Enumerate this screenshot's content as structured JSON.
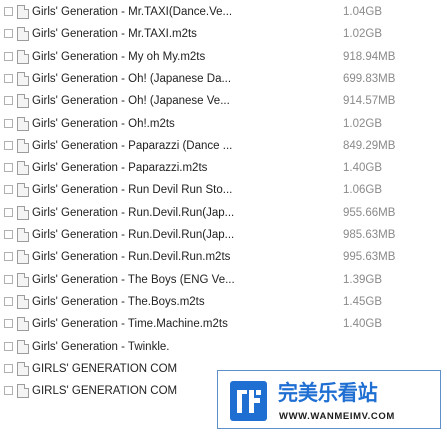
{
  "files": [
    {
      "name": "Girls' Generation - Mr.TAXI(Dance.Ve...",
      "size": "1.04GB"
    },
    {
      "name": "Girls' Generation - Mr.TAXI.m2ts",
      "size": "1.02GB"
    },
    {
      "name": "Girls' Generation - My oh My.m2ts",
      "size": "918.94MB"
    },
    {
      "name": "Girls' Generation - Oh! (Japanese Da...",
      "size": "699.83MB"
    },
    {
      "name": "Girls' Generation - Oh! (Japanese Ve...",
      "size": "914.57MB"
    },
    {
      "name": "Girls' Generation - Oh!.m2ts",
      "size": "1.02GB"
    },
    {
      "name": "Girls' Generation - Paparazzi (Dance ...",
      "size": "849.29MB"
    },
    {
      "name": "Girls' Generation - Paparazzi.m2ts",
      "size": "1.40GB"
    },
    {
      "name": "Girls' Generation - Run Devil Run Sto...",
      "size": "1.06GB"
    },
    {
      "name": "Girls' Generation - Run.Devil.Run(Jap...",
      "size": "955.66MB"
    },
    {
      "name": "Girls' Generation - Run.Devil.Run(Jap...",
      "size": "985.63MB"
    },
    {
      "name": "Girls' Generation - Run.Devil.Run.m2ts",
      "size": "995.63MB"
    },
    {
      "name": "Girls' Generation - The Boys (ENG Ve...",
      "size": "1.39GB"
    },
    {
      "name": "Girls' Generation - The.Boys.m2ts",
      "size": "1.45GB"
    },
    {
      "name": "Girls' Generation - Time.Machine.m2ts",
      "size": "1.40GB"
    },
    {
      "name": "Girls' Generation - Twinkle.",
      "size": ""
    },
    {
      "name": "GIRLS' GENERATION COM",
      "size": ""
    },
    {
      "name": "GIRLS' GENERATION COM",
      "size": ""
    }
  ],
  "ad": {
    "brand": "完美乐看站",
    "url": "WWW.WANMEIMV.COM"
  }
}
